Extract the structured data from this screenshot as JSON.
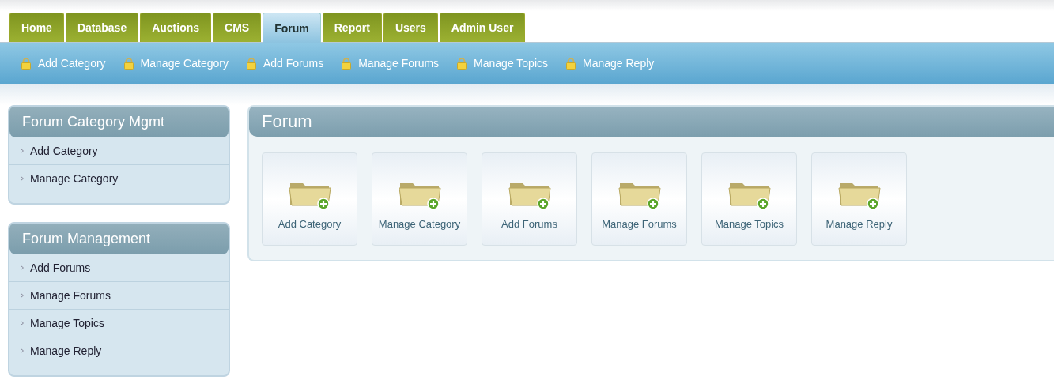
{
  "tabs": [
    {
      "label": "Home",
      "selected": false
    },
    {
      "label": "Database",
      "selected": false
    },
    {
      "label": "Auctions",
      "selected": false
    },
    {
      "label": "CMS",
      "selected": false
    },
    {
      "label": "Forum",
      "selected": true
    },
    {
      "label": "Report",
      "selected": false
    },
    {
      "label": "Users",
      "selected": false
    },
    {
      "label": "Admin User",
      "selected": false
    }
  ],
  "subnav": [
    "Add Category",
    "Manage Category",
    "Add Forums",
    "Manage Forums",
    "Manage Topics",
    "Manage Reply"
  ],
  "sidebar": [
    {
      "title": "Forum Category Mgmt",
      "items": [
        "Add Category",
        "Manage Category"
      ]
    },
    {
      "title": "Forum Management",
      "items": [
        "Add Forums",
        "Manage Forums",
        "Manage Topics",
        "Manage Reply"
      ]
    }
  ],
  "main": {
    "title": "Forum",
    "tiles": [
      "Add Category",
      "Manage Category",
      "Add Forums",
      "Manage Forums",
      "Manage Topics",
      "Manage Reply"
    ]
  }
}
